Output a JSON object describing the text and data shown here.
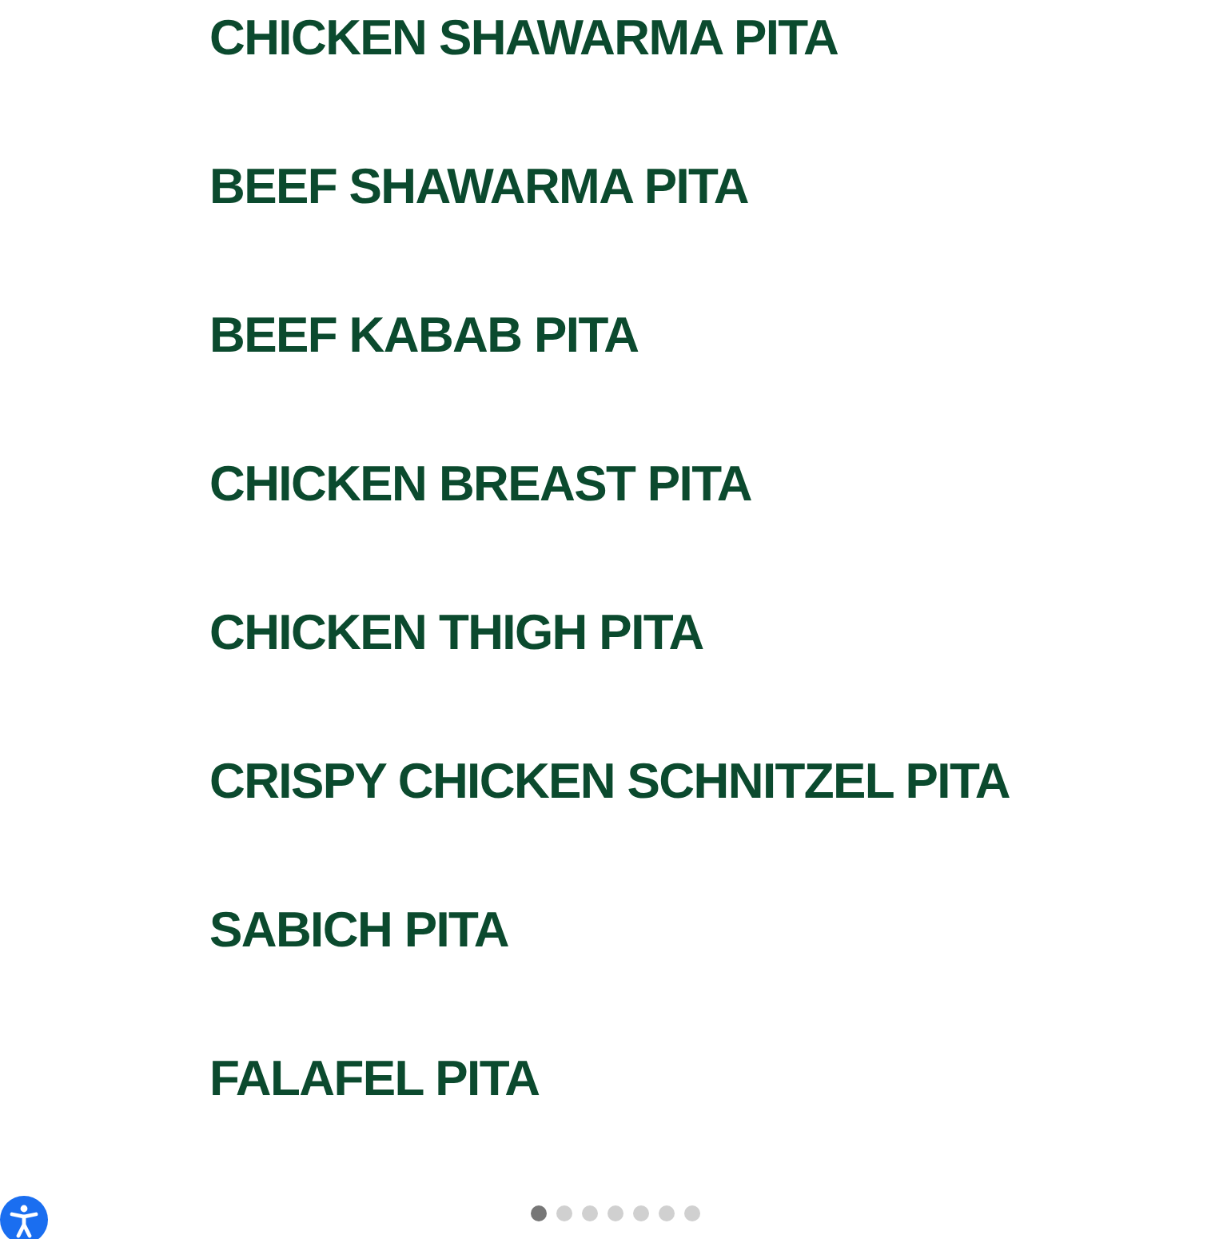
{
  "menu_items": [
    "CHICKEN SHAWARMA PITA",
    "BEEF SHAWARMA PITA",
    "BEEF KABAB PITA",
    "CHICKEN BREAST PITA",
    "CHICKEN THIGH PITA",
    "CRISPY CHICKEN SCHNITZEL PITA",
    "SABICH PITA",
    "FALAFEL PITA"
  ],
  "carousel_dots": [
    {
      "selected": true
    },
    {
      "selected": false
    },
    {
      "selected": false
    },
    {
      "selected": false
    },
    {
      "selected": false
    },
    {
      "selected": false
    },
    {
      "selected": false
    }
  ]
}
